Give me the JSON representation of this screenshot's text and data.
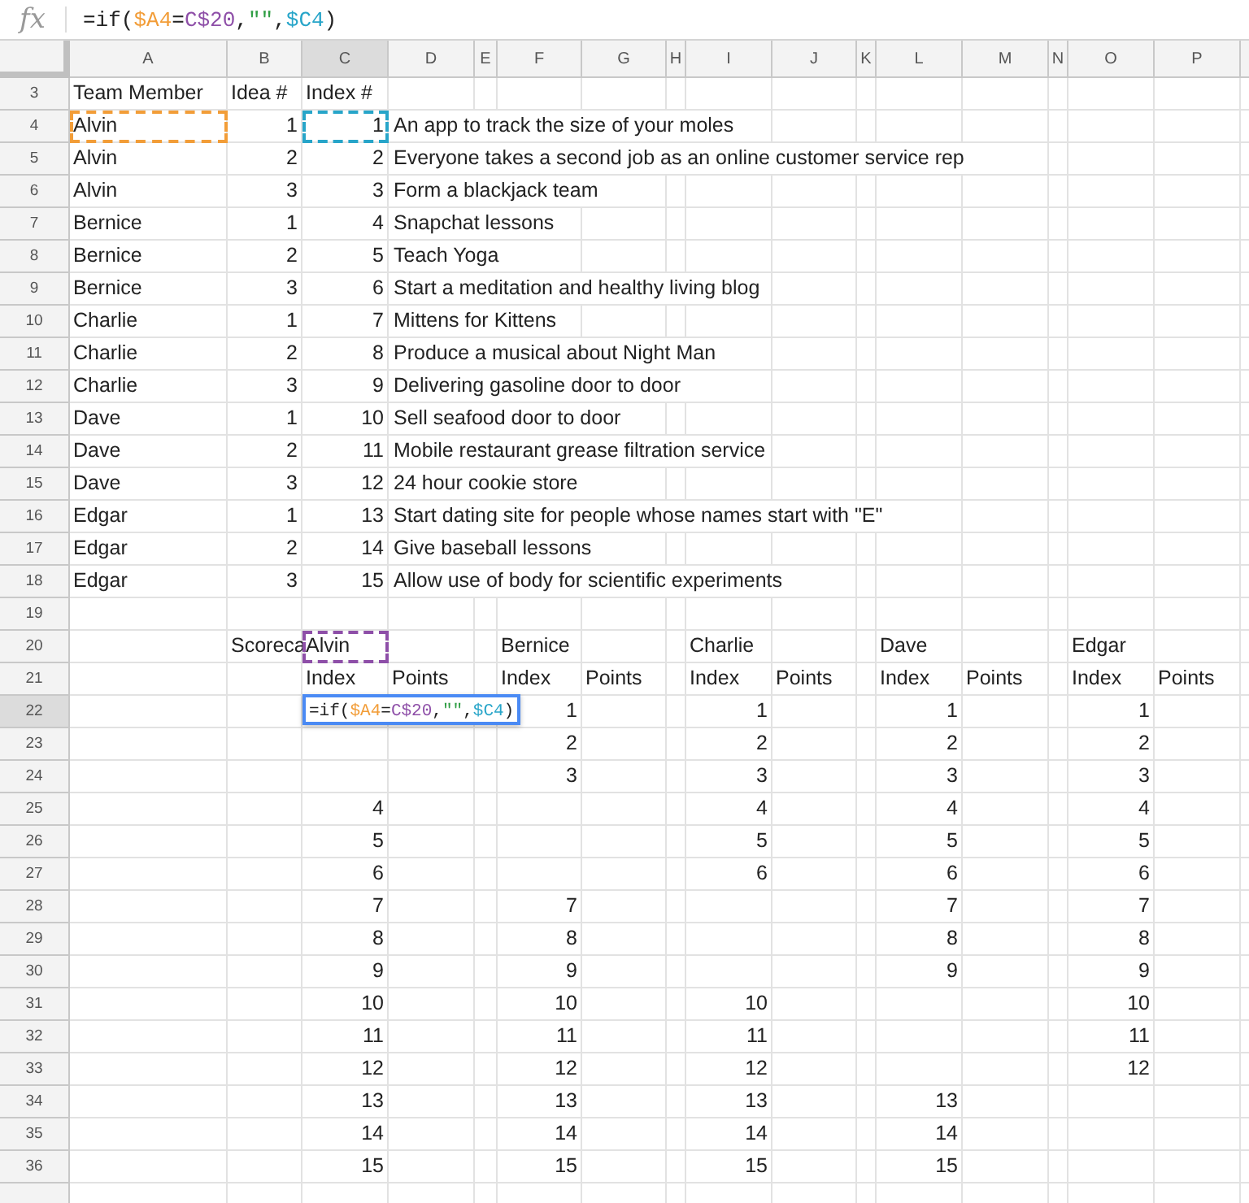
{
  "formula_bar": {
    "function_label": "fx",
    "tokens": [
      {
        "text": "=if(",
        "color": "#222222"
      },
      {
        "text": "$A4",
        "color": "#f29d38"
      },
      {
        "text": "=",
        "color": "#222222"
      },
      {
        "text": "C$20",
        "color": "#8e4fa8"
      },
      {
        "text": ",",
        "color": "#222222"
      },
      {
        "text": "\"\"",
        "color": "#2f9e44"
      },
      {
        "text": ",",
        "color": "#222222"
      },
      {
        "text": "$C4",
        "color": "#27a5c9"
      },
      {
        "text": ")",
        "color": "#222222"
      }
    ]
  },
  "columns": [
    {
      "label": "A",
      "selected": false
    },
    {
      "label": "B",
      "selected": false
    },
    {
      "label": "C",
      "selected": true
    },
    {
      "label": "D",
      "selected": false
    },
    {
      "label": "E",
      "selected": false
    },
    {
      "label": "F",
      "selected": false
    },
    {
      "label": "G",
      "selected": false
    },
    {
      "label": "H",
      "selected": false
    },
    {
      "label": "I",
      "selected": false
    },
    {
      "label": "J",
      "selected": false
    },
    {
      "label": "K",
      "selected": false
    },
    {
      "label": "L",
      "selected": false
    },
    {
      "label": "M",
      "selected": false
    },
    {
      "label": "N",
      "selected": false
    },
    {
      "label": "O",
      "selected": false
    },
    {
      "label": "P",
      "selected": false
    }
  ],
  "rows": [
    {
      "number": "3",
      "selected": false,
      "cells": [
        {
          "kind": "text",
          "text": "Team Member"
        },
        {
          "kind": "text",
          "text": "Idea #"
        },
        {
          "kind": "text",
          "text": "Index #"
        }
      ]
    },
    {
      "number": "4",
      "selected": false,
      "cells": [
        {
          "kind": "text",
          "text": "Alvin",
          "color": "#f29d38"
        },
        {
          "kind": "number",
          "text": "1"
        },
        {
          "kind": "number",
          "text": "1",
          "color": "#27a5c9"
        },
        {
          "kind": "long_text",
          "text": "An app to track the size of your moles"
        }
      ]
    },
    {
      "number": "5",
      "selected": false,
      "cells": [
        {
          "kind": "text",
          "text": "Alvin"
        },
        {
          "kind": "number",
          "text": "2"
        },
        {
          "kind": "number",
          "text": "2"
        },
        {
          "kind": "long_text",
          "text": "Everyone takes a second job as an online customer service rep"
        }
      ]
    },
    {
      "number": "6",
      "selected": false,
      "cells": [
        {
          "kind": "text",
          "text": "Alvin"
        },
        {
          "kind": "number",
          "text": "3"
        },
        {
          "kind": "number",
          "text": "3"
        },
        {
          "kind": "long_text",
          "text": "Form a blackjack team"
        }
      ]
    },
    {
      "number": "7",
      "selected": false,
      "cells": [
        {
          "kind": "text",
          "text": "Bernice"
        },
        {
          "kind": "number",
          "text": "1"
        },
        {
          "kind": "number",
          "text": "4"
        },
        {
          "kind": "long_text",
          "text": "Snapchat lessons"
        }
      ]
    },
    {
      "number": "8",
      "selected": false,
      "cells": [
        {
          "kind": "text",
          "text": "Bernice"
        },
        {
          "kind": "number",
          "text": "2"
        },
        {
          "kind": "number",
          "text": "5"
        },
        {
          "kind": "long_text",
          "text": "Teach Yoga"
        }
      ]
    },
    {
      "number": "9",
      "selected": false,
      "cells": [
        {
          "kind": "text",
          "text": "Bernice"
        },
        {
          "kind": "number",
          "text": "3"
        },
        {
          "kind": "number",
          "text": "6"
        },
        {
          "kind": "long_text",
          "text": "Start a meditation and healthy living blog"
        }
      ]
    },
    {
      "number": "10",
      "selected": false,
      "cells": [
        {
          "kind": "text",
          "text": "Charlie"
        },
        {
          "kind": "number",
          "text": "1"
        },
        {
          "kind": "number",
          "text": "7"
        },
        {
          "kind": "long_text",
          "text": "Mittens for Kittens"
        }
      ]
    },
    {
      "number": "11",
      "selected": false,
      "cells": [
        {
          "kind": "text",
          "text": "Charlie"
        },
        {
          "kind": "number",
          "text": "2"
        },
        {
          "kind": "number",
          "text": "8"
        },
        {
          "kind": "long_text",
          "text": "Produce a musical about Night Man"
        }
      ]
    },
    {
      "number": "12",
      "selected": false,
      "cells": [
        {
          "kind": "text",
          "text": "Charlie"
        },
        {
          "kind": "number",
          "text": "3"
        },
        {
          "kind": "number",
          "text": "9"
        },
        {
          "kind": "long_text",
          "text": "Delivering gasoline door to door"
        }
      ]
    },
    {
      "number": "13",
      "selected": false,
      "cells": [
        {
          "kind": "text",
          "text": "Dave"
        },
        {
          "kind": "number",
          "text": "1"
        },
        {
          "kind": "number",
          "text": "10"
        },
        {
          "kind": "long_text",
          "text": "Sell seafood door to door"
        }
      ]
    },
    {
      "number": "14",
      "selected": false,
      "cells": [
        {
          "kind": "text",
          "text": "Dave"
        },
        {
          "kind": "number",
          "text": "2"
        },
        {
          "kind": "number",
          "text": "11"
        },
        {
          "kind": "long_text",
          "text": "Mobile restaurant grease filtration service"
        }
      ]
    },
    {
      "number": "15",
      "selected": false,
      "cells": [
        {
          "kind": "text",
          "text": "Dave"
        },
        {
          "kind": "number",
          "text": "3"
        },
        {
          "kind": "number",
          "text": "12"
        },
        {
          "kind": "long_text",
          "text": "24 hour cookie store"
        }
      ]
    },
    {
      "number": "16",
      "selected": false,
      "cells": [
        {
          "kind": "text",
          "text": "Edgar"
        },
        {
          "kind": "number",
          "text": "1"
        },
        {
          "kind": "number",
          "text": "13"
        },
        {
          "kind": "long_text",
          "text": "Start dating site for people whose names start with \"E\""
        }
      ]
    },
    {
      "number": "17",
      "selected": false,
      "cells": [
        {
          "kind": "text",
          "text": "Edgar"
        },
        {
          "kind": "number",
          "text": "2"
        },
        {
          "kind": "number",
          "text": "14"
        },
        {
          "kind": "long_text",
          "text": "Give baseball lessons"
        }
      ]
    },
    {
      "number": "18",
      "selected": false,
      "cells": [
        {
          "kind": "text",
          "text": "Edgar"
        },
        {
          "kind": "number",
          "text": "3"
        },
        {
          "kind": "number",
          "text": "15"
        },
        {
          "kind": "long_text",
          "text": "Allow use of body for scientific experiments"
        }
      ]
    },
    {
      "number": "19",
      "selected": false,
      "cells": []
    },
    {
      "number": "20",
      "selected": false,
      "cells": [
        {
          "kind": "empty"
        },
        {
          "kind": "text",
          "text": "Scoreca"
        },
        {
          "kind": "text",
          "text": "Alvin",
          "color": "#8e4fa8"
        },
        {
          "kind": "empty"
        },
        {
          "kind": "empty"
        },
        {
          "kind": "text",
          "text": "Bernice"
        },
        {
          "kind": "empty"
        },
        {
          "kind": "empty"
        },
        {
          "kind": "text",
          "text": "Charlie"
        },
        {
          "kind": "empty"
        },
        {
          "kind": "empty"
        },
        {
          "kind": "text",
          "text": "Dave"
        },
        {
          "kind": "empty"
        },
        {
          "kind": "empty"
        },
        {
          "kind": "text",
          "text": "Edgar"
        }
      ]
    },
    {
      "number": "21",
      "selected": false,
      "cells": [
        {
          "kind": "empty"
        },
        {
          "kind": "empty"
        },
        {
          "kind": "text",
          "text": "Index"
        },
        {
          "kind": "text",
          "text": "Points"
        },
        {
          "kind": "empty"
        },
        {
          "kind": "text",
          "text": "Index"
        },
        {
          "kind": "text",
          "text": "Points"
        },
        {
          "kind": "empty"
        },
        {
          "kind": "text",
          "text": "Index"
        },
        {
          "kind": "text",
          "text": "Points"
        },
        {
          "kind": "empty"
        },
        {
          "kind": "text",
          "text": "Index"
        },
        {
          "kind": "text",
          "text": "Points"
        },
        {
          "kind": "empty"
        },
        {
          "kind": "text",
          "text": "Index"
        },
        {
          "kind": "text",
          "text": "Points"
        }
      ]
    },
    {
      "number": "22",
      "selected": true,
      "cells": [
        {
          "kind": "empty"
        },
        {
          "kind": "empty"
        },
        {
          "kind": "editor",
          "tokens": [
            {
              "text": "=if(",
              "color": "#222222"
            },
            {
              "text": "$A4",
              "color": "#f29d38"
            },
            {
              "text": "=",
              "color": "#222222"
            },
            {
              "text": "C$20",
              "color": "#8e4fa8"
            },
            {
              "text": ",",
              "color": "#222222"
            },
            {
              "text": "\"\"",
              "color": "#2f9e44"
            },
            {
              "text": ",",
              "color": "#222222"
            },
            {
              "text": "$C4",
              "color": "#27a5c9"
            },
            {
              "text": ")",
              "color": "#222222"
            }
          ]
        },
        {
          "kind": "empty"
        },
        {
          "kind": "empty"
        },
        {
          "kind": "number",
          "text": "1"
        },
        {
          "kind": "empty"
        },
        {
          "kind": "empty"
        },
        {
          "kind": "number",
          "text": "1"
        },
        {
          "kind": "empty"
        },
        {
          "kind": "empty"
        },
        {
          "kind": "number",
          "text": "1"
        },
        {
          "kind": "empty"
        },
        {
          "kind": "empty"
        },
        {
          "kind": "number",
          "text": "1"
        }
      ]
    },
    {
      "number": "23",
      "selected": false,
      "cells": [
        {
          "kind": "empty"
        },
        {
          "kind": "empty"
        },
        {
          "kind": "empty"
        },
        {
          "kind": "empty"
        },
        {
          "kind": "empty"
        },
        {
          "kind": "number",
          "text": "2"
        },
        {
          "kind": "empty"
        },
        {
          "kind": "empty"
        },
        {
          "kind": "number",
          "text": "2"
        },
        {
          "kind": "empty"
        },
        {
          "kind": "empty"
        },
        {
          "kind": "number",
          "text": "2"
        },
        {
          "kind": "empty"
        },
        {
          "kind": "empty"
        },
        {
          "kind": "number",
          "text": "2"
        }
      ]
    },
    {
      "number": "24",
      "selected": false,
      "cells": [
        {
          "kind": "empty"
        },
        {
          "kind": "empty"
        },
        {
          "kind": "empty"
        },
        {
          "kind": "empty"
        },
        {
          "kind": "empty"
        },
        {
          "kind": "number",
          "text": "3"
        },
        {
          "kind": "empty"
        },
        {
          "kind": "empty"
        },
        {
          "kind": "number",
          "text": "3"
        },
        {
          "kind": "empty"
        },
        {
          "kind": "empty"
        },
        {
          "kind": "number",
          "text": "3"
        },
        {
          "kind": "empty"
        },
        {
          "kind": "empty"
        },
        {
          "kind": "number",
          "text": "3"
        }
      ]
    },
    {
      "number": "25",
      "selected": false,
      "cells": [
        {
          "kind": "empty"
        },
        {
          "kind": "empty"
        },
        {
          "kind": "number",
          "text": "4"
        },
        {
          "kind": "empty"
        },
        {
          "kind": "empty"
        },
        {
          "kind": "empty"
        },
        {
          "kind": "empty"
        },
        {
          "kind": "empty"
        },
        {
          "kind": "number",
          "text": "4"
        },
        {
          "kind": "empty"
        },
        {
          "kind": "empty"
        },
        {
          "kind": "number",
          "text": "4"
        },
        {
          "kind": "empty"
        },
        {
          "kind": "empty"
        },
        {
          "kind": "number",
          "text": "4"
        }
      ]
    },
    {
      "number": "26",
      "selected": false,
      "cells": [
        {
          "kind": "empty"
        },
        {
          "kind": "empty"
        },
        {
          "kind": "number",
          "text": "5"
        },
        {
          "kind": "empty"
        },
        {
          "kind": "empty"
        },
        {
          "kind": "empty"
        },
        {
          "kind": "empty"
        },
        {
          "kind": "empty"
        },
        {
          "kind": "number",
          "text": "5"
        },
        {
          "kind": "empty"
        },
        {
          "kind": "empty"
        },
        {
          "kind": "number",
          "text": "5"
        },
        {
          "kind": "empty"
        },
        {
          "kind": "empty"
        },
        {
          "kind": "number",
          "text": "5"
        }
      ]
    },
    {
      "number": "27",
      "selected": false,
      "cells": [
        {
          "kind": "empty"
        },
        {
          "kind": "empty"
        },
        {
          "kind": "number",
          "text": "6"
        },
        {
          "kind": "empty"
        },
        {
          "kind": "empty"
        },
        {
          "kind": "empty"
        },
        {
          "kind": "empty"
        },
        {
          "kind": "empty"
        },
        {
          "kind": "number",
          "text": "6"
        },
        {
          "kind": "empty"
        },
        {
          "kind": "empty"
        },
        {
          "kind": "number",
          "text": "6"
        },
        {
          "kind": "empty"
        },
        {
          "kind": "empty"
        },
        {
          "kind": "number",
          "text": "6"
        }
      ]
    },
    {
      "number": "28",
      "selected": false,
      "cells": [
        {
          "kind": "empty"
        },
        {
          "kind": "empty"
        },
        {
          "kind": "number",
          "text": "7"
        },
        {
          "kind": "empty"
        },
        {
          "kind": "empty"
        },
        {
          "kind": "number",
          "text": "7"
        },
        {
          "kind": "empty"
        },
        {
          "kind": "empty"
        },
        {
          "kind": "empty"
        },
        {
          "kind": "empty"
        },
        {
          "kind": "empty"
        },
        {
          "kind": "number",
          "text": "7"
        },
        {
          "kind": "empty"
        },
        {
          "kind": "empty"
        },
        {
          "kind": "number",
          "text": "7"
        }
      ]
    },
    {
      "number": "29",
      "selected": false,
      "cells": [
        {
          "kind": "empty"
        },
        {
          "kind": "empty"
        },
        {
          "kind": "number",
          "text": "8"
        },
        {
          "kind": "empty"
        },
        {
          "kind": "empty"
        },
        {
          "kind": "number",
          "text": "8"
        },
        {
          "kind": "empty"
        },
        {
          "kind": "empty"
        },
        {
          "kind": "empty"
        },
        {
          "kind": "empty"
        },
        {
          "kind": "empty"
        },
        {
          "kind": "number",
          "text": "8"
        },
        {
          "kind": "empty"
        },
        {
          "kind": "empty"
        },
        {
          "kind": "number",
          "text": "8"
        }
      ]
    },
    {
      "number": "30",
      "selected": false,
      "cells": [
        {
          "kind": "empty"
        },
        {
          "kind": "empty"
        },
        {
          "kind": "number",
          "text": "9"
        },
        {
          "kind": "empty"
        },
        {
          "kind": "empty"
        },
        {
          "kind": "number",
          "text": "9"
        },
        {
          "kind": "empty"
        },
        {
          "kind": "empty"
        },
        {
          "kind": "empty"
        },
        {
          "kind": "empty"
        },
        {
          "kind": "empty"
        },
        {
          "kind": "number",
          "text": "9"
        },
        {
          "kind": "empty"
        },
        {
          "kind": "empty"
        },
        {
          "kind": "number",
          "text": "9"
        }
      ]
    },
    {
      "number": "31",
      "selected": false,
      "cells": [
        {
          "kind": "empty"
        },
        {
          "kind": "empty"
        },
        {
          "kind": "number",
          "text": "10"
        },
        {
          "kind": "empty"
        },
        {
          "kind": "empty"
        },
        {
          "kind": "number",
          "text": "10"
        },
        {
          "kind": "empty"
        },
        {
          "kind": "empty"
        },
        {
          "kind": "number",
          "text": "10"
        },
        {
          "kind": "empty"
        },
        {
          "kind": "empty"
        },
        {
          "kind": "empty"
        },
        {
          "kind": "empty"
        },
        {
          "kind": "empty"
        },
        {
          "kind": "number",
          "text": "10"
        }
      ]
    },
    {
      "number": "32",
      "selected": false,
      "cells": [
        {
          "kind": "empty"
        },
        {
          "kind": "empty"
        },
        {
          "kind": "number",
          "text": "11"
        },
        {
          "kind": "empty"
        },
        {
          "kind": "empty"
        },
        {
          "kind": "number",
          "text": "11"
        },
        {
          "kind": "empty"
        },
        {
          "kind": "empty"
        },
        {
          "kind": "number",
          "text": "11"
        },
        {
          "kind": "empty"
        },
        {
          "kind": "empty"
        },
        {
          "kind": "empty"
        },
        {
          "kind": "empty"
        },
        {
          "kind": "empty"
        },
        {
          "kind": "number",
          "text": "11"
        }
      ]
    },
    {
      "number": "33",
      "selected": false,
      "cells": [
        {
          "kind": "empty"
        },
        {
          "kind": "empty"
        },
        {
          "kind": "number",
          "text": "12"
        },
        {
          "kind": "empty"
        },
        {
          "kind": "empty"
        },
        {
          "kind": "number",
          "text": "12"
        },
        {
          "kind": "empty"
        },
        {
          "kind": "empty"
        },
        {
          "kind": "number",
          "text": "12"
        },
        {
          "kind": "empty"
        },
        {
          "kind": "empty"
        },
        {
          "kind": "empty"
        },
        {
          "kind": "empty"
        },
        {
          "kind": "empty"
        },
        {
          "kind": "number",
          "text": "12"
        }
      ]
    },
    {
      "number": "34",
      "selected": false,
      "cells": [
        {
          "kind": "empty"
        },
        {
          "kind": "empty"
        },
        {
          "kind": "number",
          "text": "13"
        },
        {
          "kind": "empty"
        },
        {
          "kind": "empty"
        },
        {
          "kind": "number",
          "text": "13"
        },
        {
          "kind": "empty"
        },
        {
          "kind": "empty"
        },
        {
          "kind": "number",
          "text": "13"
        },
        {
          "kind": "empty"
        },
        {
          "kind": "empty"
        },
        {
          "kind": "number",
          "text": "13"
        }
      ]
    },
    {
      "number": "35",
      "selected": false,
      "cells": [
        {
          "kind": "empty"
        },
        {
          "kind": "empty"
        },
        {
          "kind": "number",
          "text": "14"
        },
        {
          "kind": "empty"
        },
        {
          "kind": "empty"
        },
        {
          "kind": "number",
          "text": "14"
        },
        {
          "kind": "empty"
        },
        {
          "kind": "empty"
        },
        {
          "kind": "number",
          "text": "14"
        },
        {
          "kind": "empty"
        },
        {
          "kind": "empty"
        },
        {
          "kind": "number",
          "text": "14"
        }
      ]
    },
    {
      "number": "36",
      "selected": false,
      "cells": [
        {
          "kind": "empty"
        },
        {
          "kind": "empty"
        },
        {
          "kind": "number",
          "text": "15"
        },
        {
          "kind": "empty"
        },
        {
          "kind": "empty"
        },
        {
          "kind": "number",
          "text": "15"
        },
        {
          "kind": "empty"
        },
        {
          "kind": "empty"
        },
        {
          "kind": "number",
          "text": "15"
        },
        {
          "kind": "empty"
        },
        {
          "kind": "empty"
        },
        {
          "kind": "number",
          "text": "15"
        }
      ]
    }
  ]
}
